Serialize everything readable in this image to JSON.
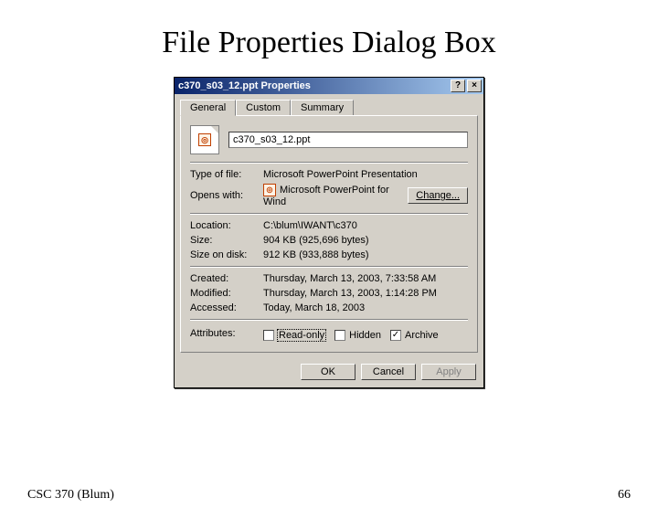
{
  "slide": {
    "title": "File Properties Dialog Box",
    "footer_left": "CSC 370 (Blum)",
    "footer_right": "66"
  },
  "dialog": {
    "title": "c370_s03_12.ppt Properties",
    "help_glyph": "?",
    "close_glyph": "×",
    "tabs": {
      "general": "General",
      "custom": "Custom",
      "summary": "Summary"
    },
    "filename": "c370_s03_12.ppt",
    "labels": {
      "type": "Type of file:",
      "opens": "Opens with:",
      "location": "Location:",
      "size": "Size:",
      "size_on_disk": "Size on disk:",
      "created": "Created:",
      "modified": "Modified:",
      "accessed": "Accessed:",
      "attributes": "Attributes:"
    },
    "values": {
      "type": "Microsoft PowerPoint Presentation",
      "opens": "Microsoft PowerPoint for Wind",
      "location": "C:\\blum\\IWANT\\c370",
      "size": "904 KB (925,696 bytes)",
      "size_on_disk": "912 KB (933,888 bytes)",
      "created": "Thursday, March 13, 2003, 7:33:58 AM",
      "modified": "Thursday, March 13, 2003, 1:14:28 PM",
      "accessed": "Today, March 18, 2003"
    },
    "change_btn": "Change...",
    "attributes": {
      "readonly": "Read-only",
      "hidden": "Hidden",
      "archive": "Archive",
      "archive_check": "✓"
    },
    "buttons": {
      "ok": "OK",
      "cancel": "Cancel",
      "apply": "Apply"
    }
  }
}
